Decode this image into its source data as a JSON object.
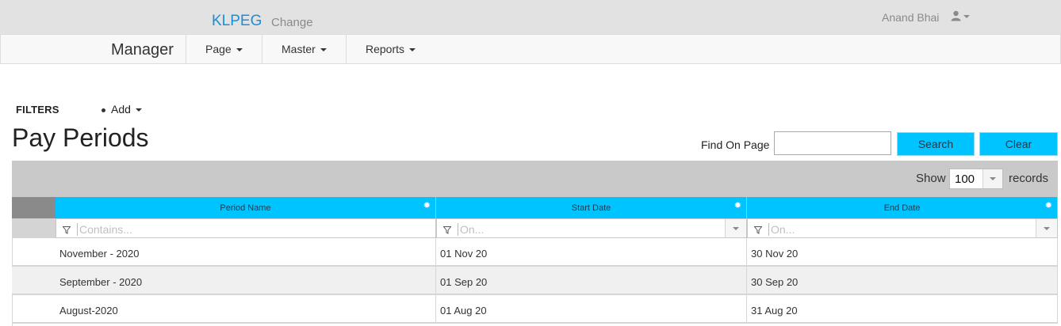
{
  "header": {
    "brand": "KLPEG",
    "change_link": "Change",
    "user_name": "Anand Bhai"
  },
  "nav": {
    "title": "Manager",
    "items": [
      {
        "label": "Page"
      },
      {
        "label": "Master"
      },
      {
        "label": "Reports"
      }
    ]
  },
  "filters": {
    "label": "FILTERS",
    "add_label": "Add"
  },
  "page": {
    "title": "Pay Periods"
  },
  "find": {
    "label": "Find On Page",
    "value": "",
    "search_label": "Search",
    "clear_label": "Clear"
  },
  "pager": {
    "show_label": "Show",
    "page_size": "100",
    "records_label": "records"
  },
  "grid": {
    "columns": [
      {
        "header": "Period Name",
        "filter_placeholder": "Contains..."
      },
      {
        "header": "Start Date",
        "filter_placeholder": "On..."
      },
      {
        "header": "End Date",
        "filter_placeholder": "On..."
      }
    ],
    "rows": [
      {
        "period_name": "November - 2020",
        "start_date": "01 Nov 20",
        "end_date": "30 Nov 20"
      },
      {
        "period_name": "September - 2020",
        "start_date": "01 Sep 20",
        "end_date": "30 Sep 20"
      },
      {
        "period_name": "August-2020",
        "start_date": "01 Aug 20",
        "end_date": "31 Aug 20"
      }
    ]
  },
  "colors": {
    "brand": "#1a8fd6",
    "header_cyan": "#00c4ff",
    "topbar": "#e2e2e2"
  },
  "icons": {
    "user": "user-icon",
    "gear": "gear-icon",
    "filter": "filter-icon"
  }
}
